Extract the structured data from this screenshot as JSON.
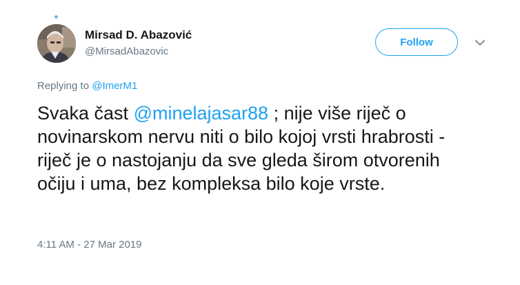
{
  "author": {
    "name": "Mirsad D. Abazović",
    "handle": "@MirsadAbazovic"
  },
  "follow_button": {
    "label": "Follow"
  },
  "reply_context": {
    "prefix": "Replying to ",
    "handle": "@ImerM1"
  },
  "tweet": {
    "text_before_mention": "Svaka čast ",
    "mention": "@minelajasar88",
    "text_after_mention": " ; nije više riječ o novinarskom nervu niti o bilo kojoj vrsti hrabrosti - riječ je o nastojanju da sve gleda širom otvorenih očiju i uma, bez kompleksa bilo koje vrste."
  },
  "timestamp": "4:11 AM - 27 Mar 2019",
  "colors": {
    "accent": "#1da1f2",
    "text_primary": "#14171a",
    "text_secondary": "#657786"
  },
  "icons": {
    "caret": "chevron-down-icon"
  }
}
